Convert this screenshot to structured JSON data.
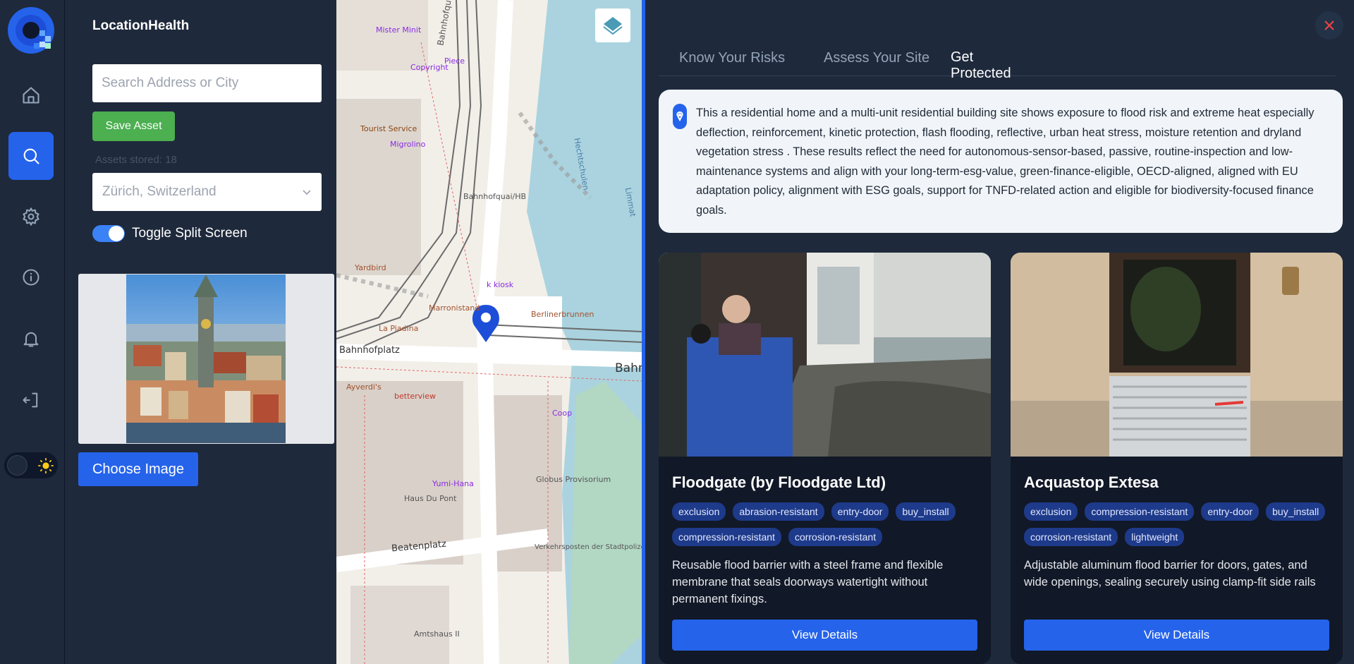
{
  "app": {
    "title": "LocationHealth"
  },
  "search": {
    "placeholder": "Search Address or City",
    "value": ""
  },
  "save_asset_label": "Save Asset",
  "assets_stored": "Assets stored: 18",
  "location_select": {
    "selected": "Zürich, Switzerland"
  },
  "split_screen": {
    "label": "Toggle Split Screen",
    "on": true
  },
  "choose_image_label": "Choose Image",
  "rail": {
    "items": [
      {
        "icon": "home-icon"
      },
      {
        "icon": "search-icon",
        "active": true
      },
      {
        "icon": "gear-icon"
      },
      {
        "icon": "info-icon"
      },
      {
        "icon": "bell-icon"
      },
      {
        "icon": "logout-icon"
      }
    ],
    "theme_icon": "sun-icon"
  },
  "map": {
    "labels": [
      "Bahnhofquai",
      "Bahnhofplatz",
      "Beatenplatz",
      "Bahnhofquai/HB",
      "Berlinerbrunnen",
      "Marronistand",
      "Yardbird",
      "Tourist Service",
      "Migrolino",
      "betterview",
      "Ayverdi's",
      "Coop",
      "Globus Provisorium",
      "Verkehrsposten der Stadtpolizei Zürich",
      "Haus Du Pont",
      "Yumi-Hana",
      "Amtshaus II",
      "Copyright",
      "Mister Minit",
      "Piece",
      "Limmat",
      "Hechtschulen",
      "k kiosk",
      "La Piadina",
      "Bahn"
    ]
  },
  "accent_colors": {
    "primary": "#2563eb",
    "success": "#4caf50",
    "danger": "#ef4444"
  },
  "tabs": [
    {
      "label": "Know Your Risks"
    },
    {
      "label": "Assess Your Site"
    },
    {
      "label": "Get Protected",
      "active": true
    }
  ],
  "summary": "This a residential home and a multi-unit residential building site shows exposure to flood risk and extreme heat especially deflection, reinforcement, kinetic protection, flash flooding, reflective, urban heat stress, moisture retention and dryland vegetation stress . These results reflect the need for autonomous-sensor-based, passive, routine-inspection and low-maintenance systems and align with your long-term-esg-value, green-finance-eligible, OECD-aligned, aligned with EU adaptation policy, alignment with ESG goals, support for TNFD-related action and eligible for biodiversity-focused finance goals.",
  "products": [
    {
      "title": "Floodgate (by Floodgate Ltd)",
      "tags": [
        "exclusion",
        "abrasion-resistant",
        "entry-door",
        "buy_install",
        "compression-resistant",
        "corrosion-resistant"
      ],
      "description": "Reusable flood barrier with a steel frame and flexible membrane that seals doorways watertight without permanent fixings.",
      "button": "View Details"
    },
    {
      "title": "Acquastop Extesa",
      "tags": [
        "exclusion",
        "compression-resistant",
        "entry-door",
        "buy_install",
        "corrosion-resistant",
        "lightweight"
      ],
      "description": "Adjustable aluminum flood barrier for doors, gates, and wide openings, sealing securely using clamp-fit side rails",
      "button": "View Details"
    }
  ]
}
